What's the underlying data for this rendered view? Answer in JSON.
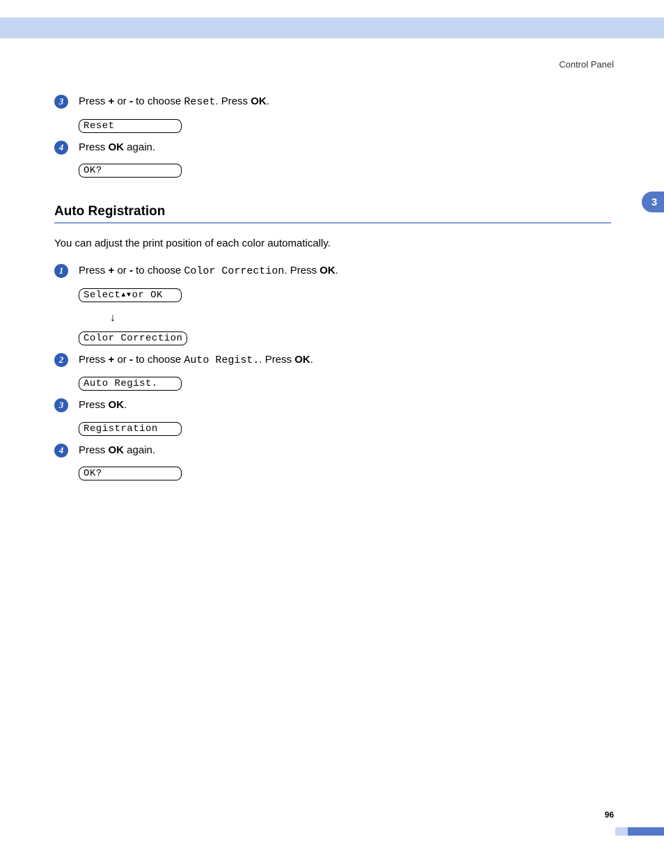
{
  "header": {
    "title": "Control Panel"
  },
  "side_tab": {
    "label": "3"
  },
  "section1": {
    "steps": [
      {
        "num": "3",
        "prefix": "Press ",
        "b1": "+",
        "mid1": " or ",
        "b2": "-",
        "mid2": " to choose ",
        "mono": "Reset",
        "after_mono": ".",
        "mid3": " Press ",
        "b3": "OK",
        "end": ".",
        "lcd": "Reset"
      },
      {
        "num": "4",
        "prefix": "Press ",
        "b1": "OK",
        "end": " again.",
        "lcd": "OK?"
      }
    ]
  },
  "section2": {
    "heading": "Auto Registration",
    "intro": "You can adjust the print position of each color automatically.",
    "steps": [
      {
        "num": "1",
        "prefix": "Press ",
        "b1": "+",
        "mid1": " or ",
        "b2": "-",
        "mid2": " to choose ",
        "mono": "Color Correction",
        "after_mono": ".",
        "mid3": " Press ",
        "b3": "OK",
        "end": ".",
        "lcd1_prefix": "Select ",
        "lcd1_suffix": " or OK",
        "lcd2": "Color Correction"
      },
      {
        "num": "2",
        "prefix": "Press ",
        "b1": "+",
        "mid1": " or ",
        "b2": "-",
        "mid2": " to choose ",
        "mono": "Auto Regist.",
        "after_mono": ".",
        "mid3": " Press ",
        "b3": "OK",
        "end": ".",
        "lcd": "Auto Regist."
      },
      {
        "num": "3",
        "prefix": "Press ",
        "b1": "OK",
        "end": ".",
        "lcd": "Registration"
      },
      {
        "num": "4",
        "prefix": "Press ",
        "b1": "OK",
        "end": " again.",
        "lcd": "OK?"
      }
    ]
  },
  "footer": {
    "page_number": "96"
  }
}
